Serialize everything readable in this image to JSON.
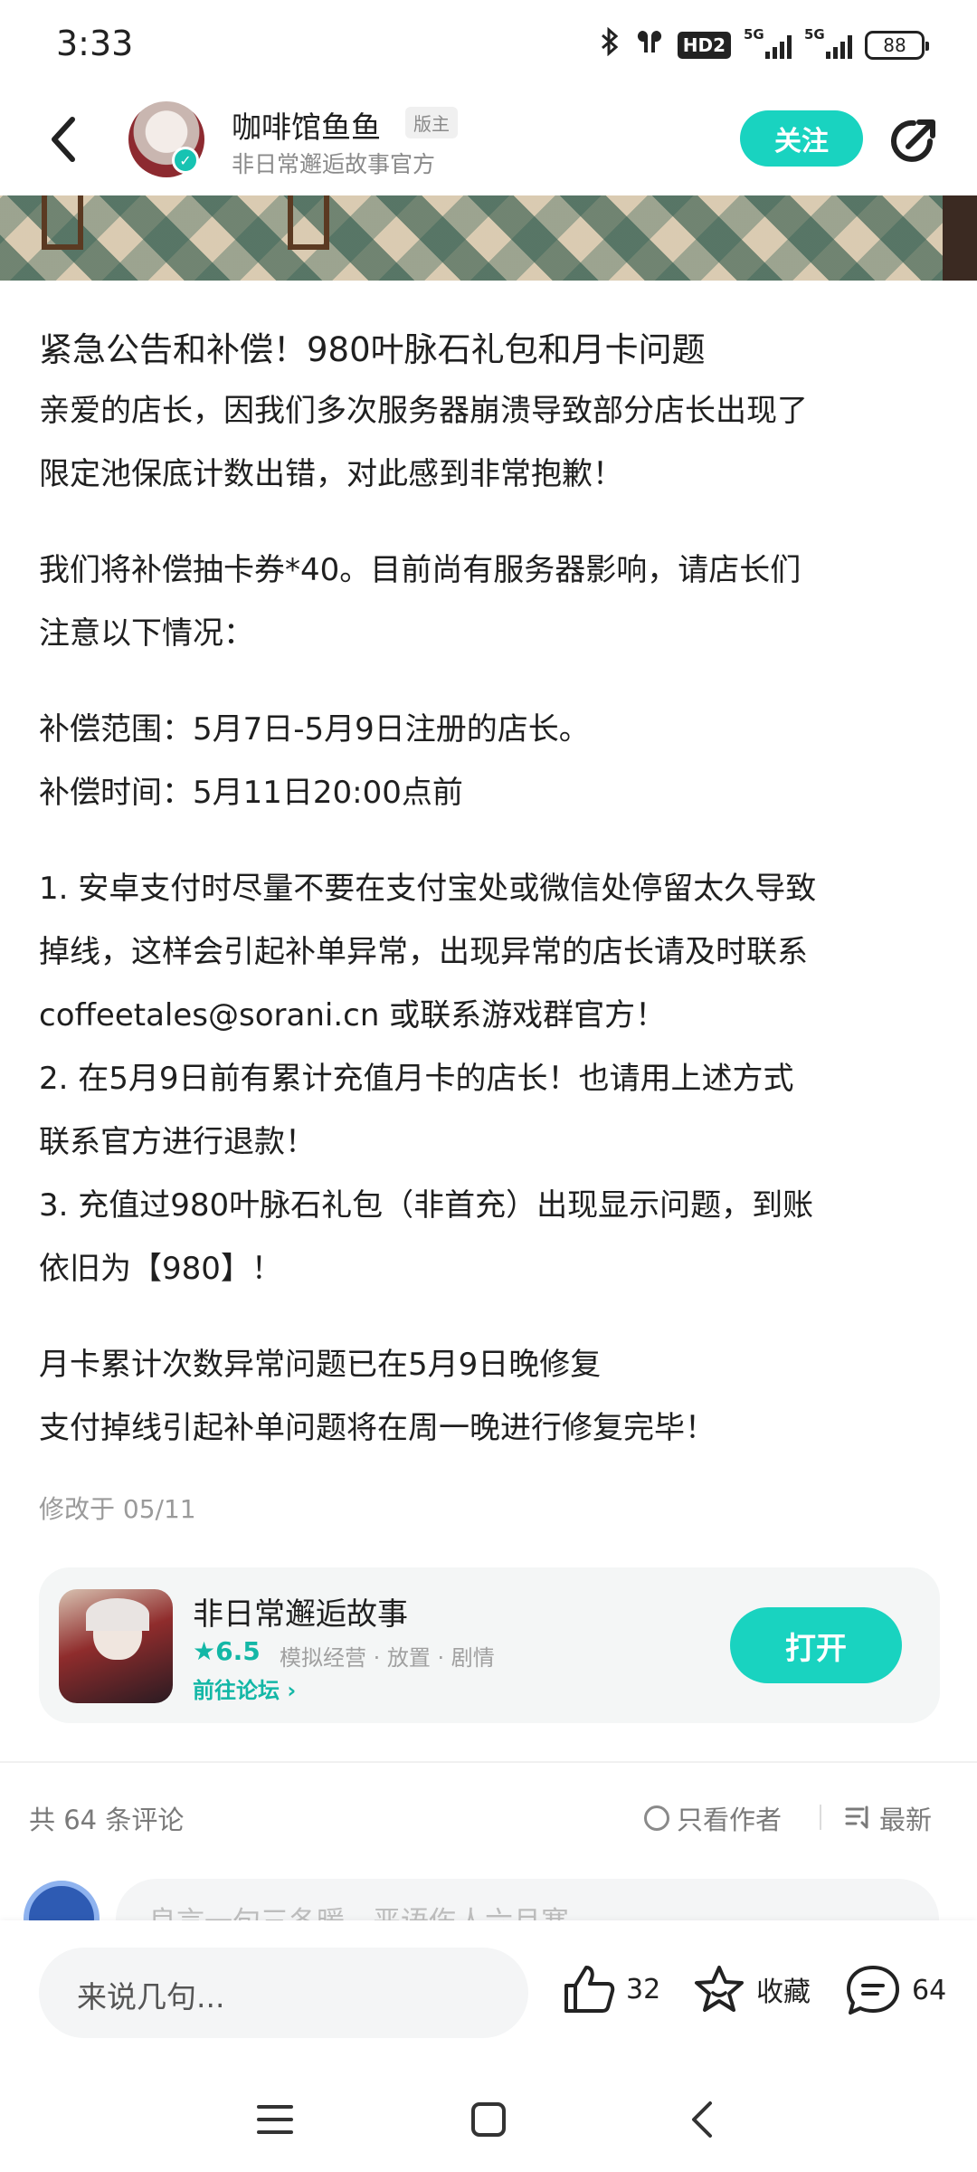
{
  "status_bar": {
    "time": "3:33",
    "bluetooth_icon": "bluetooth-icon",
    "earbuds_icon": "earbuds-icon",
    "hd_label": "HD2",
    "network_1": "5G",
    "network_2": "5G",
    "battery": "88"
  },
  "header": {
    "author_name": "咖啡馆鱼鱼",
    "mod_badge": "版主",
    "author_subtitle": "非日常邂逅故事官方",
    "follow_label": "关注"
  },
  "post": {
    "title": "紧急公告和补偿！980叶脉石礼包和月卡问题",
    "lines": [
      "亲爱的店长，因我们多次服务器崩溃导致部分店长出现了",
      "限定池保底计数出错，对此感到非常抱歉！",
      "我们将补偿抽卡券*40。目前尚有服务器影响，请店长们",
      "注意以下情况：",
      "补偿范围：5月7日-5月9日注册的店长。",
      "补偿时间：5月11日20:00点前",
      "1. 安卓支付时尽量不要在支付宝处或微信处停留太久导致",
      "掉线，这样会引起补单异常，出现异常的店长请及时联系",
      "coffeetales@sorani.cn 或联系游戏群官方！",
      "2. 在5月9日前有累计充值月卡的店长！也请用上述方式",
      "联系官方进行退款！",
      "3. 充值过980叶脉石礼包（非首充）出现显示问题，到账",
      "依旧为【980】！",
      "月卡累计次数异常问题已在5月9日晚修复",
      "支付掉线引起补单问题将在周一晚进行修复完毕！"
    ],
    "edited": "修改于 05/11"
  },
  "game_card": {
    "name": "非日常邂逅故事",
    "rating": "6.5",
    "tags": "模拟经营 · 放置 · 剧情",
    "forum_link": "前往论坛",
    "open_label": "打开"
  },
  "comments": {
    "count_label": "共 64 条评论",
    "author_only_label": "只看作者",
    "sort_label": "最新",
    "input_placeholder_partial": "良言一句三冬暖，恶语伤人六月寒"
  },
  "bottom_bar": {
    "reply_placeholder": "来说几句...",
    "like_count": "32",
    "favorite_label": "收藏",
    "comment_count": "64"
  },
  "colors": {
    "accent": "#19d3c0",
    "accent_text": "#13b7a6",
    "muted": "#8a8a8a"
  }
}
